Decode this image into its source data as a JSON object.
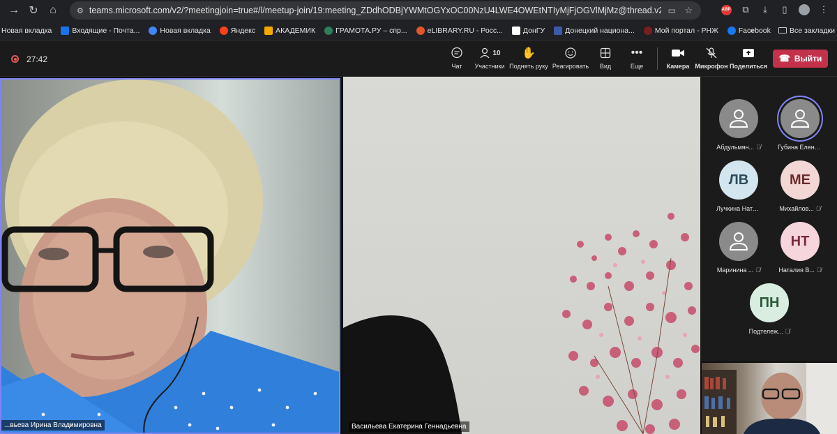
{
  "browser": {
    "url": "teams.microsoft.com/v2/?meetingjoin=true#/l/meetup-join/19:meeting_ZDdhODBjYWMtOGYxOC00NzU4LWE4OWEtNTIyMjFjOGVlMjMz@thread.v2/0?context=%7..."
  },
  "bookmarks": [
    {
      "label": "Новая вкладка",
      "color": "#8ab4f8"
    },
    {
      "label": "Входящие - Почта...",
      "color": "#1a73e8"
    },
    {
      "label": "Новая вкладка",
      "color": "#4285f4"
    },
    {
      "label": "Яндекс",
      "color": "#fc3f1d"
    },
    {
      "label": "АКАДЕМИК",
      "color": "#f2a900"
    },
    {
      "label": "ГРАМОТА.РУ – спр...",
      "color": "#2e7d5b"
    },
    {
      "label": "eLIBRARY.RU - Росс...",
      "color": "#e2562b"
    },
    {
      "label": "ДонГУ",
      "color": "#ffffff"
    },
    {
      "label": "Донецкий национа...",
      "color": "#3b5ba9"
    },
    {
      "label": "Мой портал - РНЖ",
      "color": "#7a1f1f"
    },
    {
      "label": "Facebook",
      "color": "#1877f2"
    }
  ],
  "bookmarks_all": "Все закладки",
  "toolbar": {
    "timer": "27:42",
    "chat": "Чат",
    "participants": "Участники",
    "participants_count": "10",
    "raise_hand": "Поднять руку",
    "react": "Реагировать",
    "view": "Вид",
    "more": "Еще",
    "camera": "Камера",
    "mic": "Микрофон",
    "share": "Поделиться",
    "leave": "Выйти"
  },
  "tiles": {
    "left_name": "...вьева Ирина Владимировна",
    "center_name": "Васильева Екатерина Геннадьевна"
  },
  "roster": [
    {
      "name": "Абдульмян...",
      "initials": "",
      "bg": "#8a8a8a",
      "fg": "#ffffff",
      "muted": true
    },
    {
      "name": "Губина Елена ...",
      "initials": "",
      "bg": "#8a8a8a",
      "fg": "#ffffff",
      "muted": false,
      "speaking": true
    },
    {
      "name": "Лучкина Натал...",
      "initials": "ЛВ",
      "bg": "#d3e5ee",
      "fg": "#2c4a5a",
      "muted": false
    },
    {
      "name": "Михайлов...",
      "initials": "МЕ",
      "bg": "#f2d7d5",
      "fg": "#6b2a2a",
      "muted": true
    },
    {
      "name": "Маринина ...",
      "initials": "",
      "bg": "#8a8a8a",
      "fg": "#ffffff",
      "muted": true
    },
    {
      "name": "Наталия В...",
      "initials": "НТ",
      "bg": "#f6d5dc",
      "fg": "#7a2a3b",
      "muted": true
    },
    {
      "name": "Подтележ...",
      "initials": "ПН",
      "bg": "#d9eee0",
      "fg": "#2a5a3a",
      "muted": true
    }
  ]
}
